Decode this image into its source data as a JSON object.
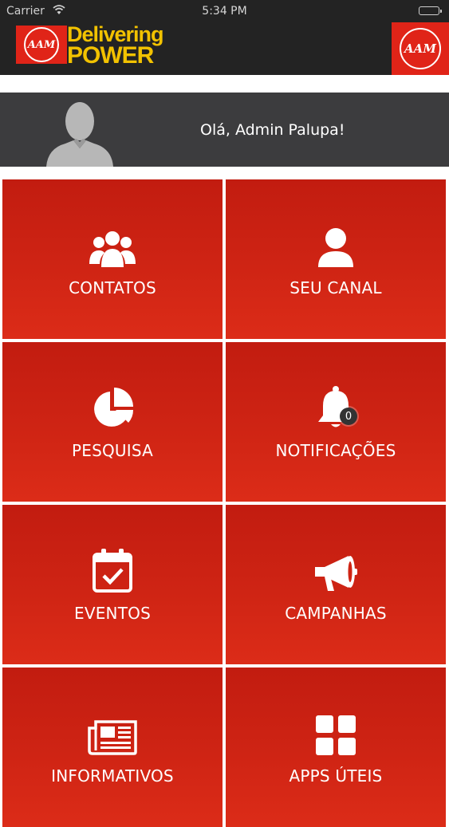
{
  "status_bar": {
    "carrier": "Carrier",
    "time": "5:34 PM"
  },
  "header": {
    "brand_line1": "Delivering",
    "brand_line2": "POWER",
    "logo_text": "AAM"
  },
  "profile": {
    "greeting": "Olá, Admin Palupa!"
  },
  "menu": {
    "items": [
      {
        "label": "CONTATOS",
        "icon": "users-icon"
      },
      {
        "label": "SEU CANAL",
        "icon": "user-icon"
      },
      {
        "label": "PESQUISA",
        "icon": "pie-chart-icon"
      },
      {
        "label": "NOTIFICAÇÕES",
        "icon": "bell-icon",
        "badge": "0"
      },
      {
        "label": "EVENTOS",
        "icon": "calendar-check-icon"
      },
      {
        "label": "CAMPANHAS",
        "icon": "megaphone-icon"
      },
      {
        "label": "INFORMATIVOS",
        "icon": "newspaper-icon"
      },
      {
        "label": "APPS ÚTEIS",
        "icon": "apps-grid-icon"
      }
    ]
  },
  "colors": {
    "tile_red": "#cf2414",
    "brand_yellow": "#f2c200",
    "header_dark": "#232323",
    "profile_gray": "#3c3c3e"
  }
}
